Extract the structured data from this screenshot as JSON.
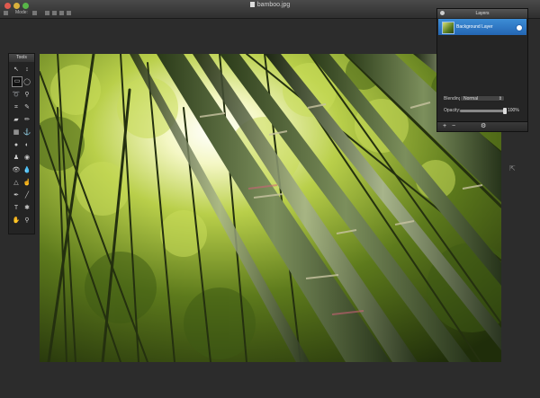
{
  "window": {
    "title": "bamboo.jpg"
  },
  "toolbar": {
    "mode_label": "Mode:"
  },
  "tools_panel": {
    "title": "Tools",
    "tools": [
      {
        "icon": "move-icon",
        "glyph": "↖"
      },
      {
        "icon": "text-move-icon",
        "glyph": "↕"
      },
      {
        "icon": "rect-select-icon",
        "glyph": "▭"
      },
      {
        "icon": "ellipse-select-icon",
        "glyph": "◯"
      },
      {
        "icon": "lasso-icon",
        "glyph": "➰"
      },
      {
        "icon": "magic-wand-icon",
        "glyph": "⚲"
      },
      {
        "icon": "crop-icon",
        "glyph": "⌗"
      },
      {
        "icon": "eyedropper-icon",
        "glyph": "✎"
      },
      {
        "icon": "eraser-icon",
        "glyph": "▰"
      },
      {
        "icon": "brush-icon",
        "glyph": "✏"
      },
      {
        "icon": "gradient-icon",
        "glyph": "▦"
      },
      {
        "icon": "stamp-icon",
        "glyph": "⚓"
      },
      {
        "icon": "paint-bucket-icon",
        "glyph": "●"
      },
      {
        "icon": "burn-icon",
        "glyph": "◐"
      },
      {
        "icon": "clone-icon",
        "glyph": "♟"
      },
      {
        "icon": "dodge-icon",
        "glyph": "◉"
      },
      {
        "icon": "eye-icon",
        "glyph": "👁"
      },
      {
        "icon": "blur-icon",
        "glyph": "💧"
      },
      {
        "icon": "sharpen-icon",
        "glyph": "△"
      },
      {
        "icon": "smudge-icon",
        "glyph": "☝"
      },
      {
        "icon": "pen-icon",
        "glyph": "✒"
      },
      {
        "icon": "line-icon",
        "glyph": "╱"
      },
      {
        "icon": "type-icon",
        "glyph": "T"
      },
      {
        "icon": "shape-icon",
        "glyph": "✱"
      },
      {
        "icon": "hand-icon",
        "glyph": "✋"
      },
      {
        "icon": "zoom-icon",
        "glyph": "⚲"
      }
    ],
    "foreground_color": "#111111",
    "background_color": "#ffffff"
  },
  "layers_panel": {
    "title": "Layers",
    "layers": [
      {
        "name": "Background Layer",
        "selected": true,
        "visible": true
      }
    ],
    "blending_label": "Blending:",
    "blending_value": "Normal",
    "opacity_label": "Opacity:",
    "opacity_value": "100%",
    "opacity_fraction": 1.0,
    "footer_buttons": [
      {
        "icon": "add-layer-icon",
        "glyph": "+"
      },
      {
        "icon": "remove-layer-icon",
        "glyph": "−"
      },
      {
        "icon": "layer-settings-icon",
        "glyph": "⚙"
      }
    ]
  },
  "colors": {
    "accent": "#2f7bd0",
    "panel_bg": "#252525",
    "app_bg": "#2c2c2c"
  }
}
